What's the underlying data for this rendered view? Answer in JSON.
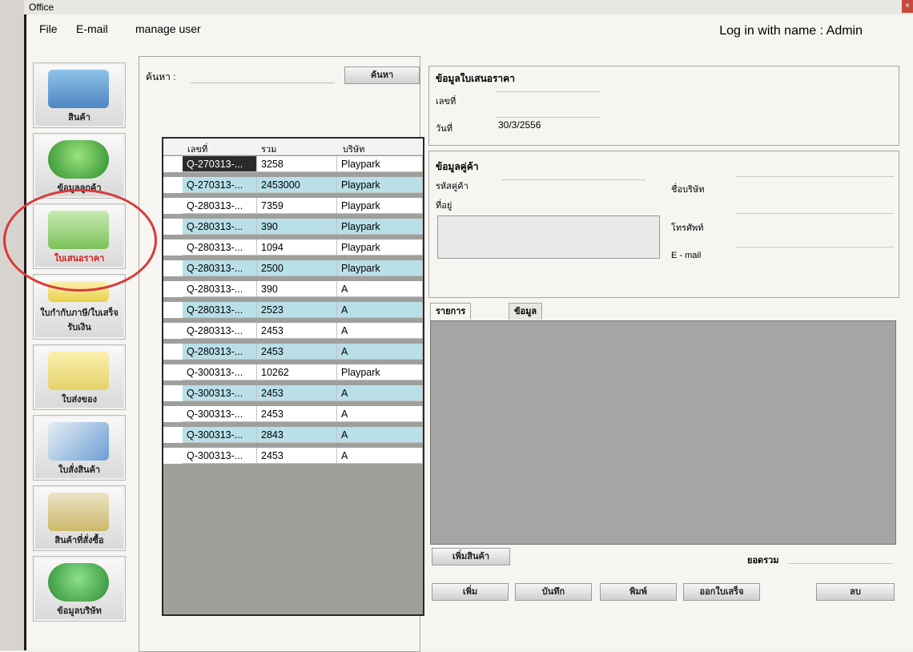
{
  "window": {
    "title": "Office",
    "close_glyph": "×"
  },
  "menu": {
    "file": "File",
    "email": "E-mail",
    "manage_user": "manage user",
    "login_text": "Log in with name : Admin"
  },
  "sidebar": {
    "items": [
      {
        "label": "สินค้า",
        "icon": "product-icon",
        "color": "#6aa7d6"
      },
      {
        "label": "ข้อมูลลูกค้า",
        "icon": "customer-icon",
        "color": "#58b548"
      },
      {
        "label": "ใบเสนอราคา",
        "icon": "quotation-icon",
        "color": "#8ccf6b"
      },
      {
        "label": "ใบกำกับภาษี/ใบเสร็จรับเงิน",
        "icon": "tax-invoice-icon",
        "color": "#e7d34a"
      },
      {
        "label": "ใบส่งของ",
        "icon": "delivery-note-icon",
        "color": "#e9d76a"
      },
      {
        "label": "ใบสั่งสินค้า",
        "icon": "purchase-order-icon",
        "color": "#7fa9d6"
      },
      {
        "label": "สินค้าที่สั่งซื้อ",
        "icon": "ordered-products-icon",
        "color": "#d7c476"
      },
      {
        "label": "ข้อมูลบริษัท",
        "icon": "company-info-icon",
        "color": "#4fb05a"
      }
    ],
    "active_index": 2
  },
  "search": {
    "label": "ค้นหา :",
    "value": "",
    "button": "ค้นหา"
  },
  "table": {
    "headers": [
      "เลขที่",
      "รวม",
      "บริษัท"
    ],
    "rows": [
      [
        "Q-270313-...",
        "3258",
        "Playpark"
      ],
      [
        "Q-270313-...",
        "2453000",
        "Playpark"
      ],
      [
        "Q-280313-...",
        "7359",
        "Playpark"
      ],
      [
        "Q-280313-...",
        "390",
        "Playpark"
      ],
      [
        "Q-280313-...",
        "1094",
        "Playpark"
      ],
      [
        "Q-280313-...",
        "2500",
        "Playpark"
      ],
      [
        "Q-280313-...",
        "390",
        "A"
      ],
      [
        "Q-280313-...",
        "2523",
        "A"
      ],
      [
        "Q-280313-...",
        "2453",
        "A"
      ],
      [
        "Q-280313-...",
        "2453",
        "A"
      ],
      [
        "Q-300313-...",
        "10262",
        "Playpark"
      ],
      [
        "Q-300313-...",
        "2453",
        "A"
      ],
      [
        "Q-300313-...",
        "2453",
        "A"
      ],
      [
        "Q-300313-...",
        "2843",
        "A"
      ],
      [
        "Q-300313-...",
        "2453",
        "A"
      ]
    ],
    "selected_row": 0,
    "row_colors": {
      "odd": "#ffffff",
      "even": "#b9dfe8",
      "selected": "#2b2b2b"
    }
  },
  "quote_info": {
    "title": "ข้อมูลใบเสนอราคา",
    "number_label": "เลขที่",
    "number_value": "",
    "date_label": "วันที่",
    "date_value": "30/3/2556"
  },
  "customer_info": {
    "title": "ข้อมูลคู่ค้า",
    "code_label": "รหัสคู่ค้า",
    "address_label": "ที่อยู่",
    "company_label": "ชื่อบริษัท",
    "phone_label": "โทรศัพท์",
    "email_label": "E - mail"
  },
  "tabs": {
    "items": [
      "รายการสินค้า",
      "ข้อมูลราคา"
    ],
    "active_index": 0
  },
  "product_panel": {
    "add_product_button": "เพิ่มสินค้า",
    "total_label": "ยอดรวม"
  },
  "actions": {
    "add": "เพิ่ม",
    "save": "บันทึก",
    "print": "พิมพ์",
    "issue_receipt": "ออกใบเสร็จ",
    "delete": "ลบ"
  }
}
